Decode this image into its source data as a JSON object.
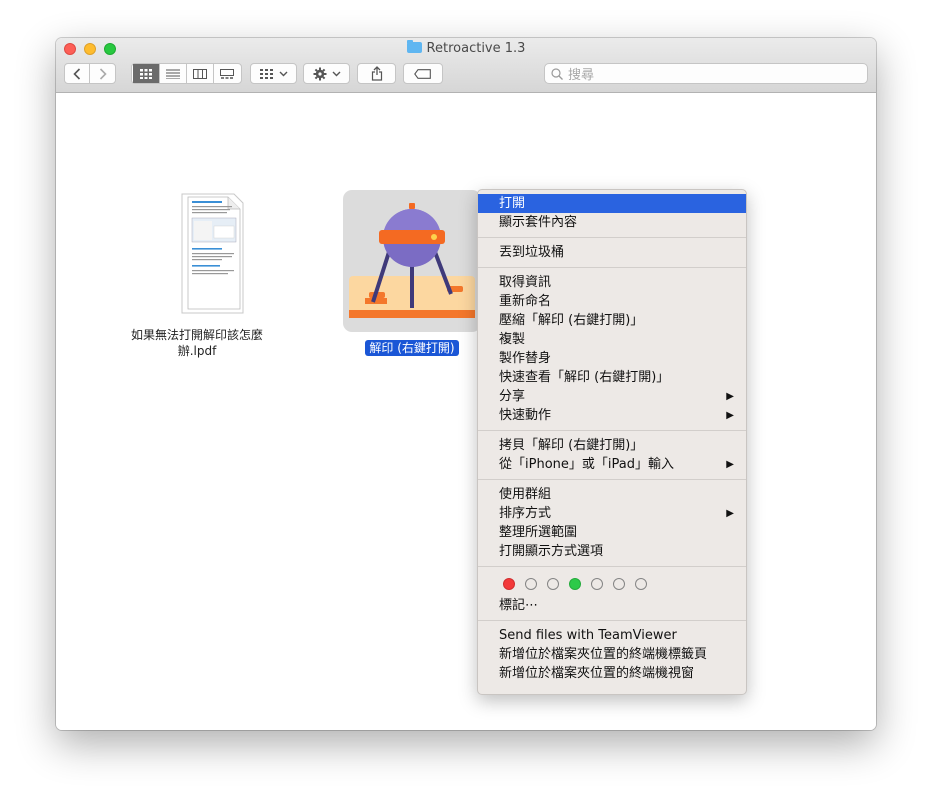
{
  "window": {
    "title": "Retroactive 1.3"
  },
  "toolbar": {
    "search_placeholder": "搜尋"
  },
  "files": [
    {
      "name_line1": "如果無法打開解印該怎麼",
      "name_line2": "辦.lpdf"
    },
    {
      "name": "解印 (右鍵打開)",
      "selected": true
    }
  ],
  "context_menu": {
    "groups": [
      [
        "打開",
        "顯示套件內容"
      ],
      [
        "丟到垃圾桶"
      ],
      [
        "取得資訊",
        "重新命名",
        "壓縮「解印 (右鍵打開)」",
        "複製",
        "製作替身",
        "快速查看「解印 (右鍵打開)」",
        "分享",
        "快速動作"
      ],
      [
        "拷貝「解印 (右鍵打開)」",
        "從「iPhone」或「iPad」輸入"
      ],
      [
        "使用群組",
        "排序方式",
        "整理所選範圍",
        "打開顯示方式選項"
      ],
      [
        "標記⋯"
      ],
      [
        "Send files with TeamViewer",
        "新增位於檔案夾位置的終端機標籤頁",
        "新增位於檔案夾位置的終端機視窗"
      ]
    ],
    "highlighted": "打開",
    "submenu_arrow": "▶",
    "tag_colors": [
      "#f3393a",
      "none",
      "none",
      "#2dca49",
      "none",
      "none",
      "none"
    ]
  },
  "colors": {
    "selection": "#1a56d6",
    "menu_highlight": "#2a63e0"
  }
}
